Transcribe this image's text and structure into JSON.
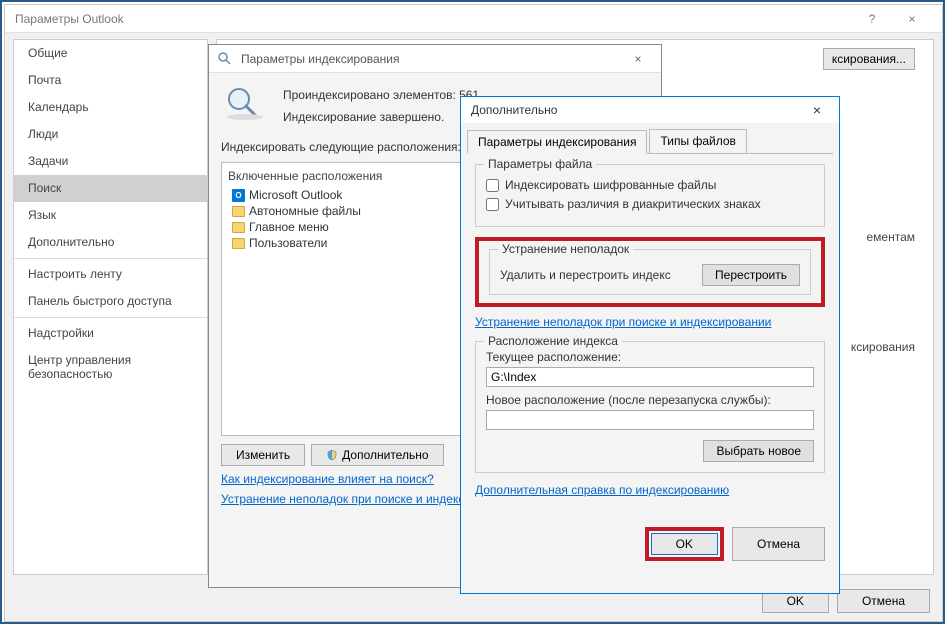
{
  "outlook": {
    "title": "Параметры Outlook",
    "help": "?",
    "close": "×",
    "sidebar": [
      {
        "label": "Общие"
      },
      {
        "label": "Почта"
      },
      {
        "label": "Календарь"
      },
      {
        "label": "Люди"
      },
      {
        "label": "Задачи"
      },
      {
        "label": "Поиск",
        "selected": true
      },
      {
        "label": "Язык"
      },
      {
        "label": "Дополнительно"
      }
    ],
    "sidebar2": [
      {
        "label": "Настроить ленту"
      },
      {
        "label": "Панель быстрого доступа"
      }
    ],
    "sidebar3": [
      {
        "label": "Надстройки"
      },
      {
        "label": "Центр управления безопасностью"
      }
    ],
    "main_btn_partial": "ксирования...",
    "main_text1": "ементам",
    "main_text2": "ксирования",
    "ok": "OK",
    "cancel": "Отмена"
  },
  "indexing": {
    "title": "Параметры индексирования",
    "indexed_text": "Проиндексировано элементов: 561",
    "complete_text": "Индексирование завершено.",
    "locations_label": "Индексировать следующие расположения:",
    "included_header": "Включенные расположения",
    "items": [
      {
        "label": "Microsoft Outlook",
        "type": "outlook"
      },
      {
        "label": "Автономные файлы",
        "type": "folder"
      },
      {
        "label": "Главное меню",
        "type": "folder"
      },
      {
        "label": "Пользователи",
        "type": "folder"
      }
    ],
    "modify_btn": "Изменить",
    "advanced_btn": "Дополнительно",
    "link1": "Как индексирование влияет на поиск?",
    "link2": "Устранение неполадок при поиске и индексировании"
  },
  "advanced": {
    "title": "Дополнительно",
    "tab1": "Параметры индексирования",
    "tab2": "Типы файлов",
    "file_params": "Параметры файла",
    "cb1": "Индексировать шифрованные файлы",
    "cb2": "Учитывать различия в диакритических знаках",
    "troubleshoot": "Устранение неполадок",
    "delete_rebuild": "Удалить и перестроить индекс",
    "rebuild_btn": "Перестроить",
    "troubleshoot_link": "Устранение неполадок при поиске и индексировании",
    "index_location": "Расположение индекса",
    "current_loc": "Текущее расположение:",
    "current_path": "G:\\Index",
    "new_loc": "Новое расположение (после перезапуска службы):",
    "new_path": "",
    "choose_btn": "Выбрать новое",
    "help_link": "Дополнительная справка по индексированию",
    "ok": "OK",
    "cancel": "Отмена"
  }
}
